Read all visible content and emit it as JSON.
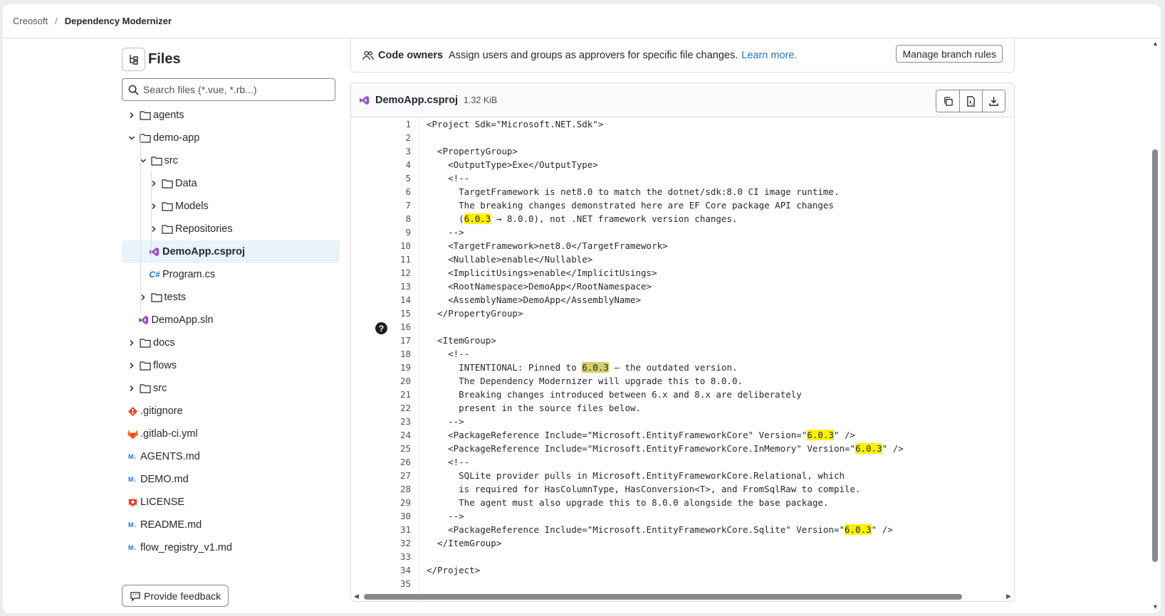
{
  "breadcrumb": {
    "root": "Creosoft",
    "separator": "/",
    "current": "Dependency Modernizer"
  },
  "sidebar": {
    "title": "Files",
    "search_placeholder": "Search files (*.vue, *.rb...)",
    "tree": [
      {
        "label": "agents",
        "type": "folder",
        "depth": 0,
        "expanded": false
      },
      {
        "label": "demo-app",
        "type": "folder",
        "depth": 0,
        "expanded": true
      },
      {
        "label": "src",
        "type": "folder",
        "depth": 1,
        "expanded": true
      },
      {
        "label": "Data",
        "type": "folder",
        "depth": 2,
        "expanded": false
      },
      {
        "label": "Models",
        "type": "folder",
        "depth": 2,
        "expanded": false
      },
      {
        "label": "Repositories",
        "type": "folder",
        "depth": 2,
        "expanded": false
      },
      {
        "label": "DemoApp.csproj",
        "type": "csproj",
        "depth": 2,
        "selected": true
      },
      {
        "label": "Program.cs",
        "type": "csharp",
        "depth": 2
      },
      {
        "label": "tests",
        "type": "folder",
        "depth": 1,
        "expanded": false
      },
      {
        "label": "DemoApp.sln",
        "type": "sln",
        "depth": 1
      },
      {
        "label": "docs",
        "type": "folder",
        "depth": 0,
        "expanded": false
      },
      {
        "label": "flows",
        "type": "folder",
        "depth": 0,
        "expanded": false
      },
      {
        "label": "src",
        "type": "folder",
        "depth": 0,
        "expanded": false
      },
      {
        "label": ".gitignore",
        "type": "git",
        "depth": 0
      },
      {
        "label": ".gitlab-ci.yml",
        "type": "gitlab",
        "depth": 0
      },
      {
        "label": "AGENTS.md",
        "type": "markdown",
        "depth": 0
      },
      {
        "label": "DEMO.md",
        "type": "markdown",
        "depth": 0
      },
      {
        "label": "LICENSE",
        "type": "license",
        "depth": 0
      },
      {
        "label": "README.md",
        "type": "markdown",
        "depth": 0
      },
      {
        "label": "flow_registry_v1.md",
        "type": "markdown",
        "depth": 0
      }
    ],
    "feedback_label": "Provide feedback"
  },
  "code_owners": {
    "title": "Code owners",
    "description": "Assign users and groups as approvers for specific file changes.",
    "link": "Learn more.",
    "button": "Manage branch rules"
  },
  "file": {
    "name": "DemoApp.csproj",
    "size": "1.32 KiB",
    "actions": [
      "copy-contents-icon",
      "open-raw-icon",
      "download-icon"
    ],
    "highlight_term": "6.0.3",
    "lines": [
      "<Project Sdk=\"Microsoft.NET.Sdk\">",
      "",
      "  <PropertyGroup>",
      "    <OutputType>Exe</OutputType>",
      "    <!--",
      "      TargetFramework is net8.0 to match the dotnet/sdk:8.0 CI image runtime.",
      "      The breaking changes demonstrated here are EF Core package API changes",
      "      (6.0.3 → 8.0.0), not .NET framework version changes.",
      "    -->",
      "    <TargetFramework>net8.0</TargetFramework>",
      "    <Nullable>enable</Nullable>",
      "    <ImplicitUsings>enable</ImplicitUsings>",
      "    <RootNamespace>DemoApp</RootNamespace>",
      "    <AssemblyName>DemoApp</AssemblyName>",
      "  </PropertyGroup>",
      "",
      "  <ItemGroup>",
      "    <!--",
      "      INTENTIONAL: Pinned to 6.0.3 — the outdated version.",
      "      The Dependency Modernizer will upgrade this to 8.0.0.",
      "      Breaking changes introduced between 6.x and 8.x are deliberately",
      "      present in the source files below.",
      "    -->",
      "    <PackageReference Include=\"Microsoft.EntityFrameworkCore\" Version=\"6.0.3\" />",
      "    <PackageReference Include=\"Microsoft.EntityFrameworkCore.InMemory\" Version=\"6.0.3\" />",
      "    <!--",
      "      SQLite provider pulls in Microsoft.EntityFrameworkCore.Relational, which",
      "      is required for HasColumnType, HasConversion<T>, and FromSqlRaw to compile.",
      "      The agent must also upgrade this to 8.0.0 alongside the base package.",
      "    -->",
      "    <PackageReference Include=\"Microsoft.EntityFrameworkCore.Sqlite\" Version=\"6.0.3\" />",
      "  </ItemGroup>",
      "",
      "</Project>",
      ""
    ],
    "current_match_line": 19,
    "help_marker_line": 17,
    "help_marker": "?"
  },
  "colors": {
    "link": "#1f75cb",
    "highlight": "#fdf100",
    "current_highlight": "#d5ce6a",
    "selected_row": "#e9f3fc"
  }
}
